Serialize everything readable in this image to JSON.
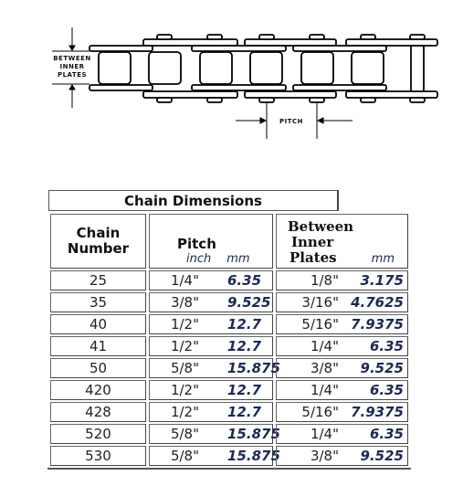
{
  "diagram": {
    "label_between_lines": [
      "BETWEEN",
      "INNER",
      "PLATES"
    ],
    "label_pitch": "PITCH"
  },
  "table": {
    "title": "Chain Dimensions",
    "headers": {
      "chain_number_lines": [
        "Chain",
        "Number"
      ],
      "pitch": "Pitch",
      "pitch_inch": "inch",
      "pitch_mm": "mm",
      "bip_lines": [
        "Between",
        "Inner",
        "Plates"
      ],
      "bip_mm": "mm"
    },
    "rows": [
      {
        "chain": "25",
        "pitch_in": "1/4\"",
        "pitch_mm": "6.35",
        "bip_in": "1/8\"",
        "bip_mm": "3.175"
      },
      {
        "chain": "35",
        "pitch_in": "3/8\"",
        "pitch_mm": "9.525",
        "bip_in": "3/16\"",
        "bip_mm": "4.7625"
      },
      {
        "chain": "40",
        "pitch_in": "1/2\"",
        "pitch_mm": "12.7",
        "bip_in": "5/16\"",
        "bip_mm": "7.9375"
      },
      {
        "chain": "41",
        "pitch_in": "1/2\"",
        "pitch_mm": "12.7",
        "bip_in": "1/4\"",
        "bip_mm": "6.35"
      },
      {
        "chain": "50",
        "pitch_in": "5/8\"",
        "pitch_mm": "15.875",
        "bip_in": "3/8\"",
        "bip_mm": "9.525"
      },
      {
        "chain": "420",
        "pitch_in": "1/2\"",
        "pitch_mm": "12.7",
        "bip_in": "1/4\"",
        "bip_mm": "6.35"
      },
      {
        "chain": "428",
        "pitch_in": "1/2\"",
        "pitch_mm": "12.7",
        "bip_in": "5/16\"",
        "bip_mm": "7.9375"
      },
      {
        "chain": "520",
        "pitch_in": "5/8\"",
        "pitch_mm": "15.875",
        "bip_in": "1/4\"",
        "bip_mm": "6.35"
      },
      {
        "chain": "530",
        "pitch_in": "5/8\"",
        "pitch_mm": "15.875",
        "bip_in": "3/8\"",
        "bip_mm": "9.525"
      }
    ]
  },
  "colors": {
    "mm_value": "#1a2a55",
    "border": "#444444"
  }
}
